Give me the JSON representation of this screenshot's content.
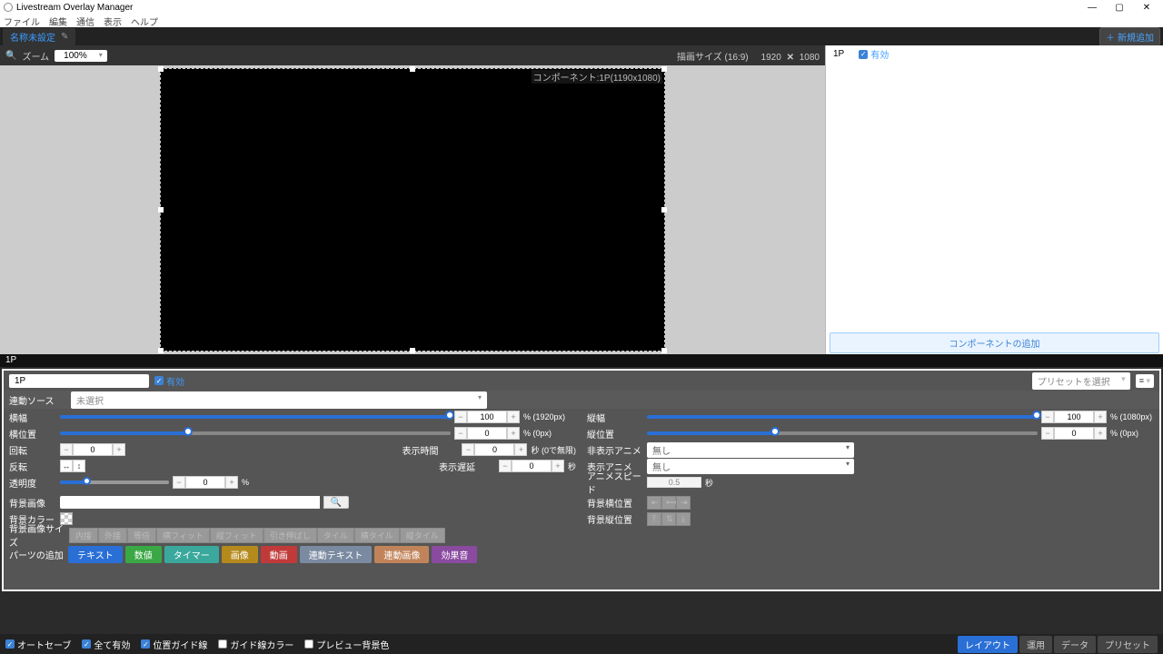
{
  "title": "Livestream Overlay Manager",
  "menu": {
    "file": "ファイル",
    "edit": "編集",
    "comm": "通信",
    "view": "表示",
    "help": "ヘルプ"
  },
  "tab": {
    "name": "名称未設定"
  },
  "newBtn": "新規追加",
  "zoom": {
    "label": "ズーム",
    "value": "100%"
  },
  "canvas": {
    "sizeLabel": "描画サイズ (16:9)",
    "w": "1920",
    "h": "1080",
    "compLabel": "コンポーネント:1P(1190x1080)"
  },
  "side": {
    "entry": "1P",
    "enable": "有効",
    "addComp": "コンポーネントの追加"
  },
  "divider": "1P",
  "prop": {
    "nameValue": "1P",
    "enable": "有効",
    "preset": "プリセットを選択",
    "sourceLabel": "連動ソース",
    "sourceValue": "未選択",
    "widthLabel": "横幅",
    "widthVal": "100",
    "widthUnit": "% (1920px)",
    "heightLabel": "縦幅",
    "heightVal": "100",
    "heightUnit": "% (1080px)",
    "xLabel": "横位置",
    "xVal": "0",
    "xUnit": "% (0px)",
    "yLabel": "縦位置",
    "yVal": "0",
    "yUnit": "% (0px)",
    "rotLabel": "回転",
    "rotVal": "0",
    "flipLabel": "反転",
    "opacityLabel": "透明度",
    "opacityVal": "0",
    "opacityUnit": "%",
    "showTimeLabel": "表示時間",
    "showTimeVal": "0",
    "showTimeUnit": "秒 (0で無限)",
    "delayLabel": "表示遅延",
    "delayVal": "0",
    "delayUnit": "秒",
    "hideAnimLabel": "非表示アニメ",
    "showAnimLabel": "表示アニメ",
    "animNone": "無し",
    "animSpeedLabel": "アニメスピード",
    "animSpeedVal": "0.5",
    "animSpeedUnit": "秒",
    "bgImageLabel": "背景画像",
    "bgColorLabel": "背景カラー",
    "bgSizeLabel": "背景画像サイズ",
    "bgHPosLabel": "背景横位置",
    "bgVPosLabel": "背景縦位置",
    "sizeOpts": {
      "inner": "内接",
      "outer": "外接",
      "equal": "等倍",
      "fitW": "横フィット",
      "fitH": "縦フィット",
      "stretch": "引き伸ばし",
      "tile": "タイル",
      "tileW": "横タイル",
      "tileH": "縦タイル"
    },
    "partsLabel": "パーツの追加",
    "parts": {
      "text": "テキスト",
      "num": "数値",
      "timer": "タイマー",
      "img": "画像",
      "vid": "動画",
      "ltxt": "連動テキスト",
      "limg": "連動画像",
      "sfx": "効果音"
    }
  },
  "footer": {
    "autosave": "オートセーブ",
    "allEnable": "全て有効",
    "guide": "位置ガイド線",
    "guideColor": "ガイド線カラー",
    "previewBg": "プレビュー背景色",
    "layout": "レイアウト",
    "operate": "運用",
    "data": "データ",
    "preset": "プリセット"
  }
}
